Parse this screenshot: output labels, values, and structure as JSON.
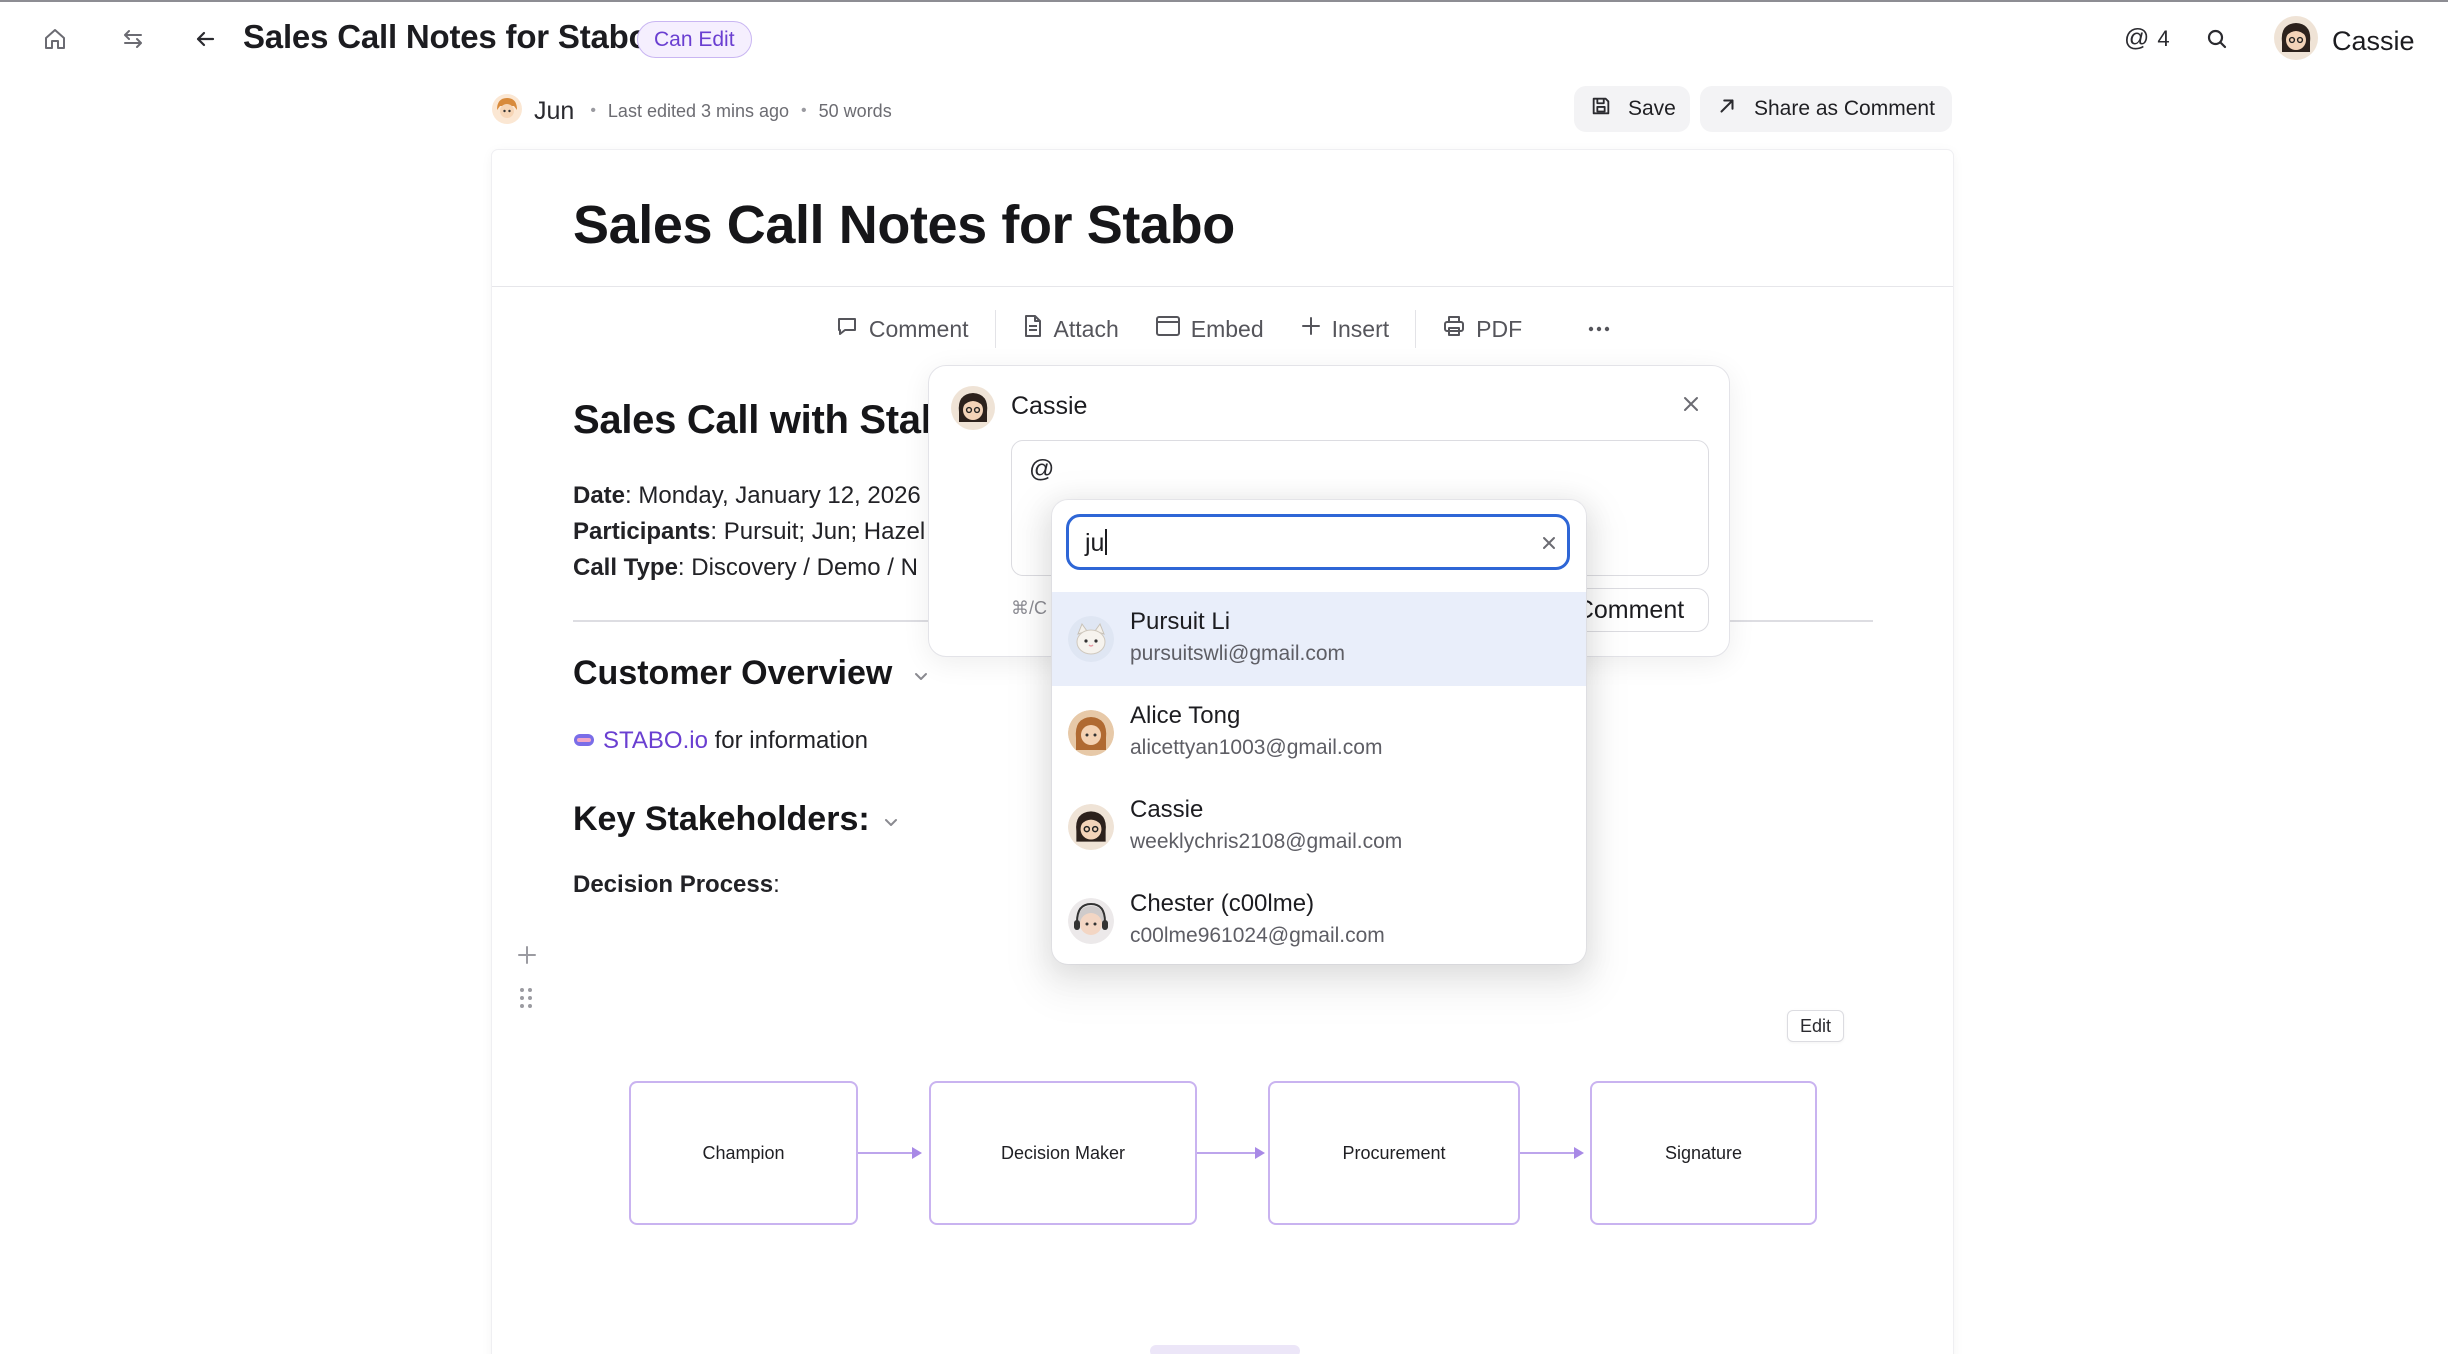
{
  "header": {
    "title": "Sales Call Notes for Stabo",
    "permission": "Can Edit",
    "mention_count": "4",
    "user_name": "Cassie"
  },
  "meta": {
    "author": "Jun",
    "last_edited": "Last edited 3 mins ago",
    "word_count": "50 words",
    "save_label": "Save",
    "share_label": "Share as Comment"
  },
  "document": {
    "title": "Sales Call Notes for Stabo",
    "toolbar": {
      "comment": "Comment",
      "attach": "Attach",
      "embed": "Embed",
      "insert": "Insert",
      "pdf": "PDF"
    },
    "section_title": "Sales Call with Stal",
    "date_label": "Date",
    "date_value": ": Monday, January 12, 2026",
    "participants_label": "Participants",
    "participants_value": ": Pursuit; Jun; Hazel",
    "call_type_label": "Call Type",
    "call_type_value": ": Discovery / Demo / N",
    "customer_overview": "Customer Overview",
    "stabo_link": "STABO.io",
    "stabo_suffix": " for information",
    "key_stakeholders": "Key Stakeholders:",
    "decision_process": "Decision Process",
    "decision_process_suffix": ":",
    "edit_label": "Edit",
    "flow": [
      "Champion",
      "Decision Maker",
      "Procurement",
      "Signature"
    ]
  },
  "comment_popover": {
    "author": "Cassie",
    "input_value": "@",
    "shortcut_hint": "⌘/C",
    "submit_label": "Comment"
  },
  "mention_dropdown": {
    "query": "ju",
    "results": [
      {
        "name": "Pursuit Li",
        "email": "pursuitswli@gmail.com"
      },
      {
        "name": "Alice Tong",
        "email": "alicettyan1003@gmail.com"
      },
      {
        "name": "Cassie",
        "email": "weeklychris2108@gmail.com"
      },
      {
        "name": "Chester (c00lme)",
        "email": "c00lme961024@gmail.com"
      }
    ]
  },
  "colors": {
    "accent": "#6a3fd1",
    "focus": "#2e66d6",
    "active_row": "#e9eefa",
    "flow_border": "#c9b3f0"
  }
}
